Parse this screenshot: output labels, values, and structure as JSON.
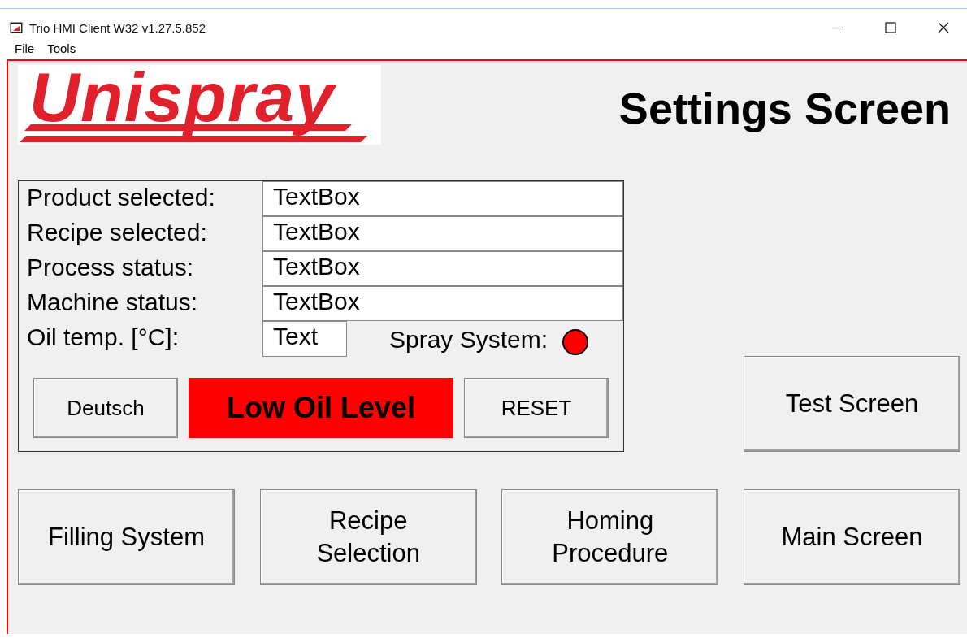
{
  "window": {
    "title": "Trio HMI Client W32 v1.27.5.852"
  },
  "menu": [
    "File",
    "Tools"
  ],
  "logo": {
    "text": "Unispray"
  },
  "heading": "Settings Screen",
  "status_panel": {
    "fields": [
      {
        "label": "Product selected:",
        "value": "TextBox"
      },
      {
        "label": "Recipe selected:",
        "value": "TextBox"
      },
      {
        "label": "Process status:",
        "value": "TextBox"
      },
      {
        "label": "Machine status:",
        "value": "TextBox"
      }
    ],
    "oil_temp": {
      "label": "Oil temp. [°C]:",
      "value": "Text"
    },
    "spray_system": {
      "label": "Spray System:",
      "color": "#ff0000"
    },
    "language_button": "Deutsch",
    "alarm": {
      "text": "Low Oil Level",
      "active": true
    },
    "reset_button": "RESET"
  },
  "side_button": "Test Screen",
  "nav_buttons": [
    "Filling System",
    "Recipe Selection",
    "Homing Procedure",
    "Main Screen"
  ]
}
